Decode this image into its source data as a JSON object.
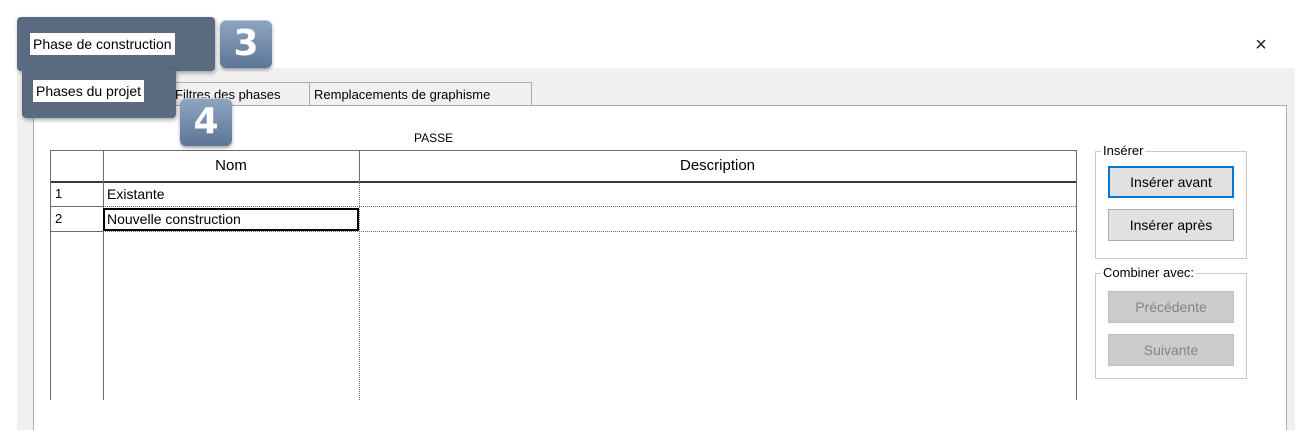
{
  "window": {
    "title": "Phase de construction",
    "close_glyph": "×"
  },
  "tabs": [
    {
      "label": "Phases du projet"
    },
    {
      "label": "Filtres des phases"
    },
    {
      "label": "Remplacements de graphisme"
    }
  ],
  "section_title": "PASSE",
  "grid": {
    "columns": [
      "Nom",
      "Description"
    ],
    "rows": [
      {
        "num": "1",
        "name": "Existante",
        "description": ""
      },
      {
        "num": "2",
        "name": "Nouvelle construction",
        "description": ""
      }
    ]
  },
  "insert_group": {
    "legend": "Insérer",
    "before_label": "Insérer avant",
    "after_label": "Insérer après"
  },
  "combine_group": {
    "legend": "Combiner avec:",
    "previous_label": "Précédente",
    "next_label": "Suivante"
  },
  "callouts": [
    {
      "number": "3"
    },
    {
      "number": "4"
    }
  ],
  "colors": {
    "accent": "#0078d7",
    "badge": "#6f87a6"
  }
}
